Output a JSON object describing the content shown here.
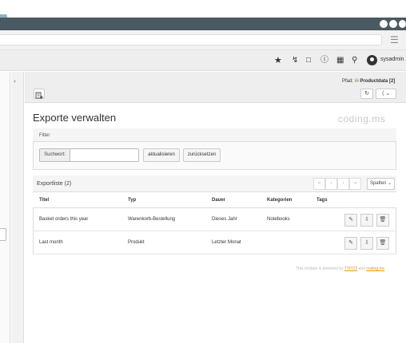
{
  "browser": {
    "menu_icon": "hamburger-icon"
  },
  "topbar": {
    "icons": [
      "star-icon",
      "bolt-icon",
      "document-icon",
      "help-icon",
      "system-info-icon",
      "search-icon"
    ],
    "username": "sysadmin"
  },
  "docheader": {
    "path_label": "Pfad:",
    "path_value": "Productdata [2]"
  },
  "page": {
    "title": "Exporte verwalten",
    "logo_text": "coding.ms"
  },
  "filter": {
    "title": "Filter",
    "search_label": "Suchwort:",
    "search_value": "",
    "refresh_label": "aktualisieren",
    "reset_label": "zurücksetzen"
  },
  "list": {
    "title": "Exportliste (2)",
    "columns_button": "Spalten",
    "columns": [
      "Titel",
      "Typ",
      "Dauer",
      "Kategorien",
      "Tags"
    ],
    "rows": [
      {
        "title": "Basket orders this year",
        "type": "Warenkorb-Bestellung",
        "duration": "Dieses Jahr",
        "categories": "Notebooks",
        "tags": ""
      },
      {
        "title": "Last month",
        "type": "Produkt",
        "duration": "Letzter Monat",
        "categories": "",
        "tags": ""
      }
    ]
  },
  "footer": {
    "prefix": "This module is powered by",
    "link1": "TYPO3",
    "middle": "and",
    "link2": "coding.ms"
  }
}
